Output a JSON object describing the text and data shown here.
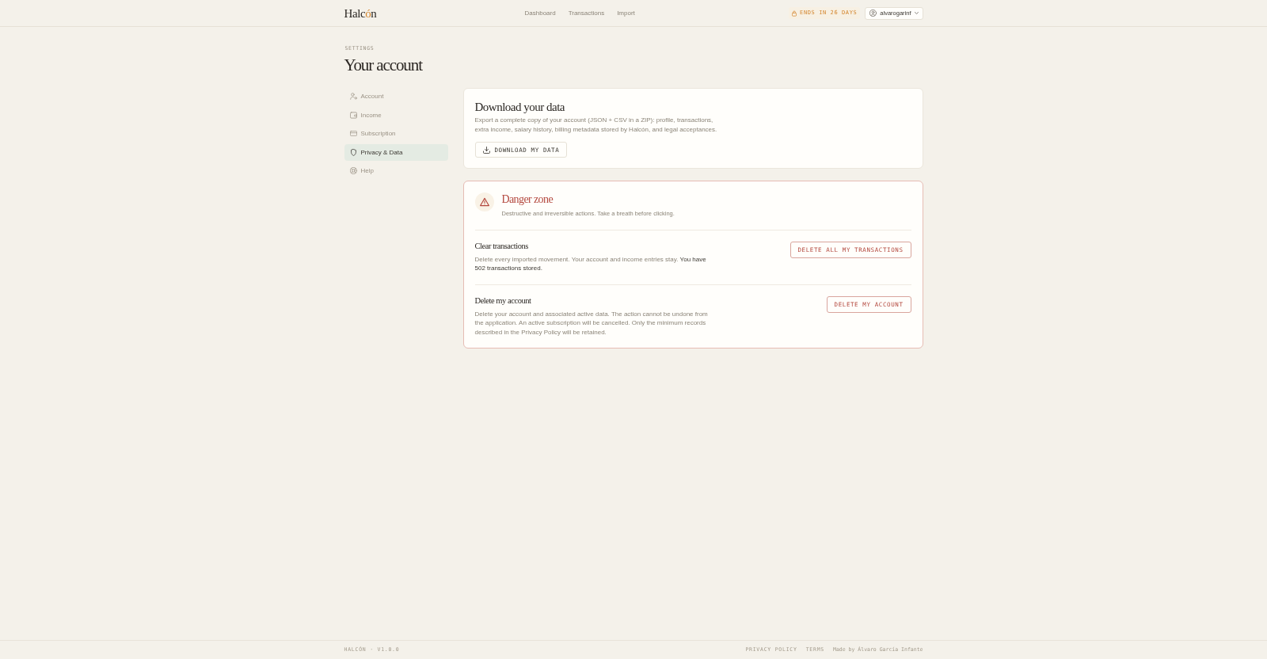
{
  "header": {
    "logo": [
      {
        "text": "Halc",
        "accent": false
      },
      {
        "text": "ó",
        "accent": true
      },
      {
        "text": "n",
        "accent": false
      }
    ],
    "nav": [
      {
        "label": "Dashboard",
        "selected": false
      },
      {
        "label": "Transactions",
        "selected": false
      },
      {
        "label": "Import",
        "selected": false
      }
    ],
    "trial_badge": "ENDS IN 26 DAYS",
    "user_menu": "alvarogarinf"
  },
  "page": {
    "eyebrow": "SETTINGS",
    "title": "Your account"
  },
  "sidebar": {
    "items": [
      {
        "label": "Account",
        "selected": false
      },
      {
        "label": "Income",
        "selected": false
      },
      {
        "label": "Subscription",
        "selected": false
      },
      {
        "label": "Privacy & Data",
        "selected": true
      },
      {
        "label": "Help",
        "selected": false
      }
    ]
  },
  "export_card": {
    "title": "Download your data",
    "description": "Export a complete copy of your account (JSON + CSV in a ZIP): profile, transactions, extra income, salary history, billing metadata stored by Halcón, and legal acceptances.",
    "button": "DOWNLOAD MY DATA"
  },
  "danger_zone": {
    "title": "Danger zone",
    "description": "Destructive and irreversible actions. Take a breath before clicking.",
    "actions": [
      {
        "title": "Clear transactions",
        "description": "Delete every imported movement. Your account and income entries stay. **You have 502 transactions stored.**",
        "button": "DELETE ALL MY TRANSACTIONS"
      },
      {
        "title": "Delete my account",
        "description": "Delete your account and associated active data. The action cannot be undone from the application. An active subscription will be cancelled. Only the minimum records described in the Privacy Policy will be retained.",
        "button": "DELETE MY ACCOUNT"
      }
    ]
  },
  "footer": {
    "version": "HALCÓN · V1.0.0",
    "links": [
      "PRIVACY POLICY",
      "TERMS"
    ],
    "credit": "Made by Álvaro García Infante"
  }
}
